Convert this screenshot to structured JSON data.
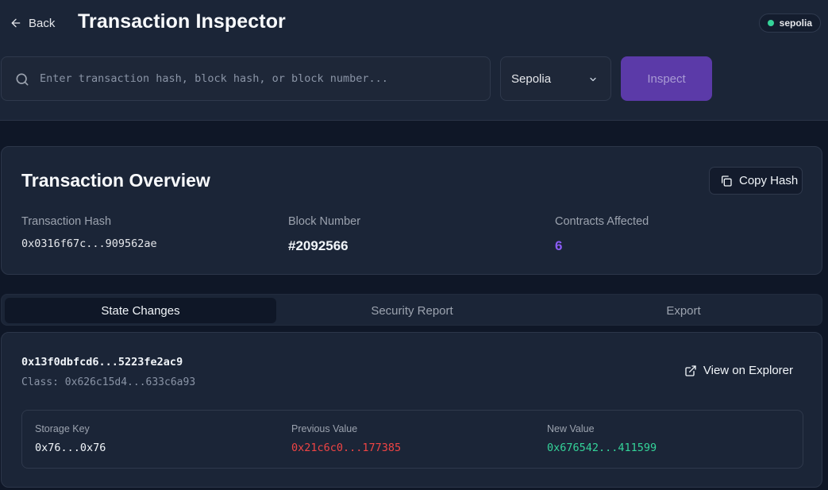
{
  "header": {
    "back_label": "Back",
    "title": "Transaction Inspector",
    "network_badge": "sepolia",
    "search_placeholder": "Enter transaction hash, block hash, or block number...",
    "search_value": "",
    "network_selected": "Sepolia",
    "inspect_label": "Inspect"
  },
  "overview": {
    "title": "Transaction Overview",
    "copy_label": "Copy Hash",
    "tx_hash_label": "Transaction Hash",
    "tx_hash_value": "0x0316f67c...909562ae",
    "block_label": "Block Number",
    "block_value": "#2092566",
    "contracts_label": "Contracts Affected",
    "contracts_value": "6"
  },
  "tabs": [
    {
      "label": "State Changes",
      "active": true
    },
    {
      "label": "Security Report",
      "active": false
    },
    {
      "label": "Export",
      "active": false
    }
  ],
  "state_change": {
    "address": "0x13f0dbfcd6...5223fe2ac9",
    "class_line": "Class: 0x626c15d4...633c6a93",
    "explorer_label": "View on Explorer",
    "storage": {
      "key_label": "Storage Key",
      "key_value": "0x76...0x76",
      "prev_label": "Previous Value",
      "prev_value": "0x21c6c0...177385",
      "new_label": "New Value",
      "new_value": "0x676542...411599"
    }
  },
  "colors": {
    "accent": "#5b3aa8",
    "contracts_count": "#8b5cf6",
    "previous_value": "#ef4444",
    "new_value": "#34d399",
    "network_dot": "#34d399"
  },
  "icons": [
    "arrow-left-icon",
    "search-icon",
    "chevron-down-icon",
    "copy-icon",
    "external-link-icon"
  ]
}
